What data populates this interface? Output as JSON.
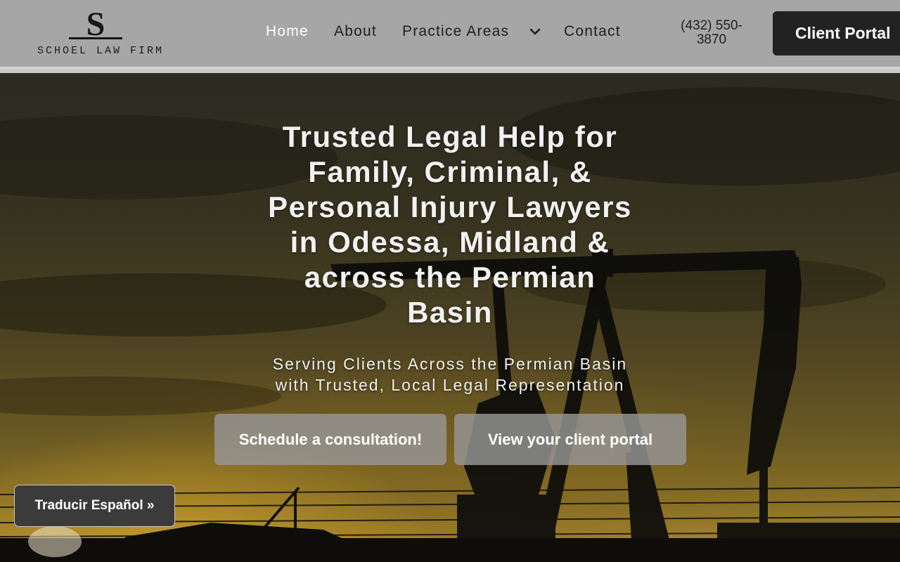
{
  "brand": {
    "logo_letter": "S",
    "name": "SCHOEL LAW FIRM"
  },
  "nav": {
    "items": [
      {
        "label": "Home",
        "active": true
      },
      {
        "label": "About"
      },
      {
        "label": "Practice Areas",
        "has_dropdown": true
      },
      {
        "label": "Contact"
      }
    ],
    "phone_line1": "(432) 550-",
    "phone_line2": "3870",
    "portal_button": "Client Portal"
  },
  "hero": {
    "title_lines": [
      "Trusted Legal Help for",
      "Family, Criminal, &",
      "Personal Injury Lawyers",
      "in Odessa, Midland &",
      "across the Permian",
      "Basin"
    ],
    "subtitle_lines": [
      "Serving Clients Across the Permian Basin",
      "with Trusted, Local Legal Representation"
    ],
    "primary_cta": "Schedule a consultation!",
    "secondary_cta": "View your client portal"
  },
  "translate_button": "Traducir Español »",
  "colors": {
    "header_bg": "#a6a6a6",
    "nav_text": "#1e1e1e",
    "nav_active": "#ffffff",
    "portal_button_bg": "#222222",
    "cta_bg": "rgba(150,150,150,0.82)",
    "sunset_gold": "#b08c2f"
  },
  "icons": {
    "dropdown": "chevron-down-icon"
  }
}
